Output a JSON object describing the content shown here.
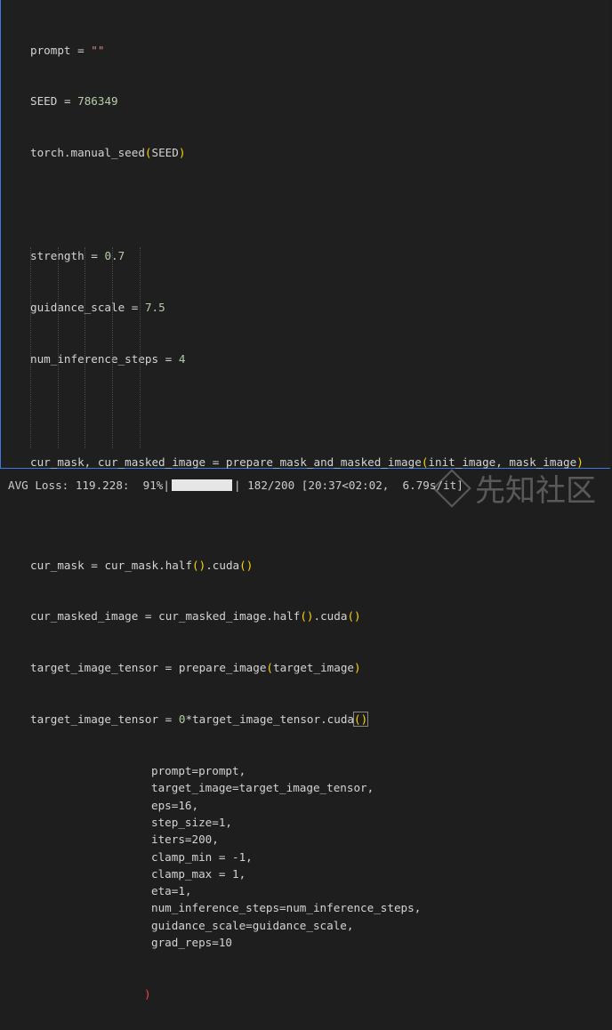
{
  "code": {
    "l1": [
      "prompt",
      "=",
      "\"\""
    ],
    "l2": [
      "SEED",
      "=",
      "786349"
    ],
    "l3": [
      "torch.manual_seed",
      "(",
      "SEED",
      ")"
    ],
    "l5": [
      "strength",
      "=",
      "0.7"
    ],
    "l6": [
      "guidance_scale",
      "=",
      "7.5"
    ],
    "l7": [
      "num_inference_steps",
      "=",
      "4"
    ],
    "l9": [
      "cur_mask, cur_masked_image",
      "=",
      "prepare_mask_and_masked_image",
      "(",
      "init_image, mask_image",
      ")"
    ],
    "l11": [
      "cur_mask",
      "=",
      "cur_mask.half",
      "()",
      ".cuda",
      "()"
    ],
    "l12": [
      "cur_masked_image",
      "=",
      "cur_masked_image.half",
      "()",
      ".cuda",
      "()"
    ],
    "l13": [
      "target_image_tensor",
      "=",
      "prepare_image",
      "(",
      "target_image",
      ")"
    ],
    "l14": [
      "target_image_tensor",
      "=",
      "0",
      "*target_image_tensor.cuda",
      "()"
    ],
    "args": [
      "prompt=prompt,",
      "target_image=target_image_tensor,",
      "eps=16,",
      "step_size=1,",
      "iters=200,",
      "clamp_min = -1,",
      "clamp_max = 1,",
      "eta=1,",
      "num_inference_steps=num_inference_steps,",
      "guidance_scale=guidance_scale,",
      "grad_reps=10"
    ],
    "close": ")"
  },
  "output": {
    "prefix": "AVG Loss: 119.228:  91%|",
    "suffix": "| 182/200 [20:37<02:02,  6.79s/it]",
    "progress": 0.91
  },
  "watermark": "先知社区"
}
